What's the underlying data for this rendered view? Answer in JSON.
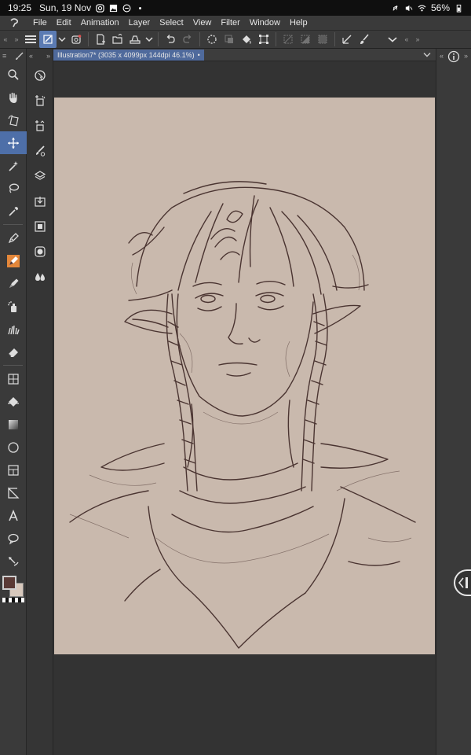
{
  "status_bar": {
    "time": "19:25",
    "date": "Sun, 19 Nov",
    "battery": "56%",
    "left_icons": [
      "instagram-icon",
      "gallery-icon",
      "minus-circle-icon",
      "dot-icon"
    ],
    "right_icons": [
      "silent-icon",
      "mute-icon",
      "wifi-icon",
      "battery-icon"
    ]
  },
  "menu": {
    "items": [
      "File",
      "Edit",
      "Animation",
      "Layer",
      "Select",
      "View",
      "Filter",
      "Window",
      "Help"
    ]
  },
  "document": {
    "tab_label": "Illustration7* (3035 x 4099px 144dpi 46.1%)",
    "close_glyph": "•"
  },
  "colors": {
    "chrome": "#3a3a3a",
    "accent": "#4e6fa8",
    "paper": "#c9b9ad",
    "ink": "#4a3431",
    "main_color": "#5a3a36",
    "sub_color": "#d7c8bc"
  },
  "toolbar": {
    "icons": [
      "hamburger-icon",
      "edit-layer-icon",
      "dropdown-icon",
      "companion-icon",
      "new-file-icon",
      "open-file-icon",
      "save-icon",
      "dropdown-icon",
      "undo-icon",
      "redo-icon",
      "loading-icon",
      "clear-icon",
      "fill-icon",
      "transform-icon",
      "deselect-icon",
      "invert-icon",
      "select-all-icon",
      "ruler-icon",
      "brush-settings-icon",
      "collapse-icon"
    ]
  },
  "tools": [
    "magnifier-icon",
    "hand-icon",
    "rotate-icon",
    "move-icon",
    "magic-wand-icon",
    "lasso-icon",
    "eyedropper-icon",
    "pen-icon",
    "pencil-icon",
    "marker-icon",
    "airbrush-icon",
    "decoration-icon",
    "eraser-icon",
    "blend-icon",
    "fill-icon",
    "gradient-icon",
    "figure-icon",
    "frame-icon",
    "ruler-icon",
    "text-icon",
    "balloon-icon",
    "correct-line-icon"
  ],
  "sub_tools": [
    "select-object-icon",
    "add-layer-icon",
    "add-folder-icon",
    "brush-icon",
    "layers-icon",
    "import-icon",
    "film-icon",
    "mask-icon",
    "droplet-icon"
  ]
}
